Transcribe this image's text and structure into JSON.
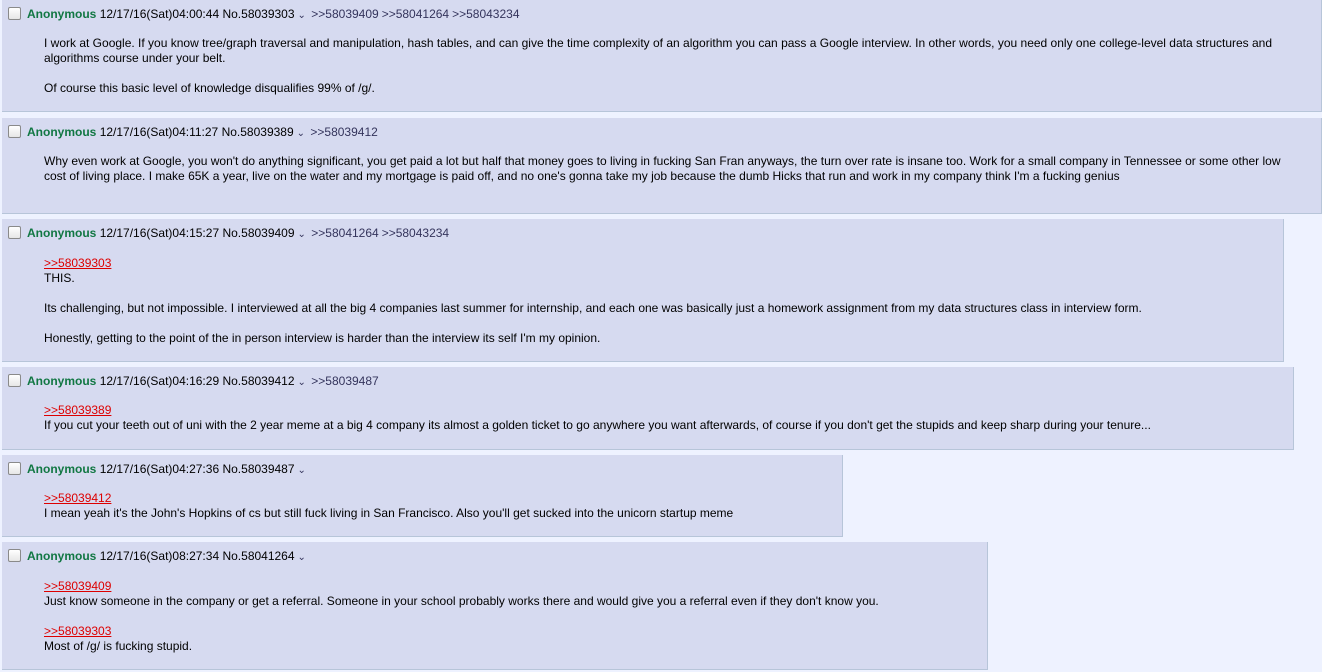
{
  "posts": [
    {
      "name": "Anonymous",
      "datetime": "12/17/16(Sat)04:00:44",
      "number": "No.58039303",
      "backlinks": [
        ">>58039409",
        ">>58041264",
        ">>58043234"
      ],
      "quote": "",
      "paragraphs": [
        "I work at Google. If you know tree/graph traversal and manipulation, hash tables, and can give the time complexity of an algorithm you can pass a Google interview. In other words, you need only one college-level data structures and algorithms course under your belt.",
        "Of course this basic level of knowledge disqualifies 99% of /g/."
      ]
    },
    {
      "name": "Anonymous",
      "datetime": "12/17/16(Sat)04:11:27",
      "number": "No.58039389",
      "backlinks": [
        ">>58039412"
      ],
      "quote": "",
      "paragraphs": [
        "Why even work at Google, you won't do anything significant, you get paid a lot but half that money goes to living in fucking San Fran anyways, the turn over rate is insane too. Work for a small company in Tennessee or some other low cost of living place. I make 65K a year, live on the water and my mortgage is paid off, and no one's gonna take my job because the dumb Hicks that run and work in my company think I'm a fucking genius"
      ]
    },
    {
      "name": "Anonymous",
      "datetime": "12/17/16(Sat)04:15:27",
      "number": "No.58039409",
      "backlinks": [
        ">>58041264",
        ">>58043234"
      ],
      "quote": ">>58039303",
      "paragraphs": [
        "THIS.",
        "Its challenging, but not impossible. I interviewed at all the big 4 companies last summer for internship, and each one was basically just a homework assignment from my data structures class in interview form.",
        "Honestly, getting to the point of the in person interview is harder than the interview its self I'm my opinion."
      ]
    },
    {
      "name": "Anonymous",
      "datetime": "12/17/16(Sat)04:16:29",
      "number": "No.58039412",
      "backlinks": [
        ">>58039487"
      ],
      "quote": ">>58039389",
      "paragraphs": [
        "If you cut your teeth out of uni with the 2 year meme at a big 4 company its almost a golden ticket to go anywhere you want afterwards, of course if you don't get the stupids and keep sharp during your tenure..."
      ]
    },
    {
      "name": "Anonymous",
      "datetime": "12/17/16(Sat)04:27:36",
      "number": "No.58039487",
      "backlinks": [],
      "quote": ">>58039412",
      "paragraphs": [
        "I mean yeah it's the John's Hopkins of cs but still fuck living in San Francisco. Also you'll get sucked into the unicorn startup meme"
      ]
    },
    {
      "name": "Anonymous",
      "datetime": "12/17/16(Sat)08:27:34",
      "number": "No.58041264",
      "backlinks": [],
      "quote": ">>58039409",
      "paragraphs": [
        "Just know someone in the company or get a referral. Someone in your school probably works there and would give you a referral even if they don't know you."
      ],
      "quote2": ">>58039303",
      "paragraphs2": [
        "Most of /g/ is fucking stupid."
      ]
    }
  ]
}
